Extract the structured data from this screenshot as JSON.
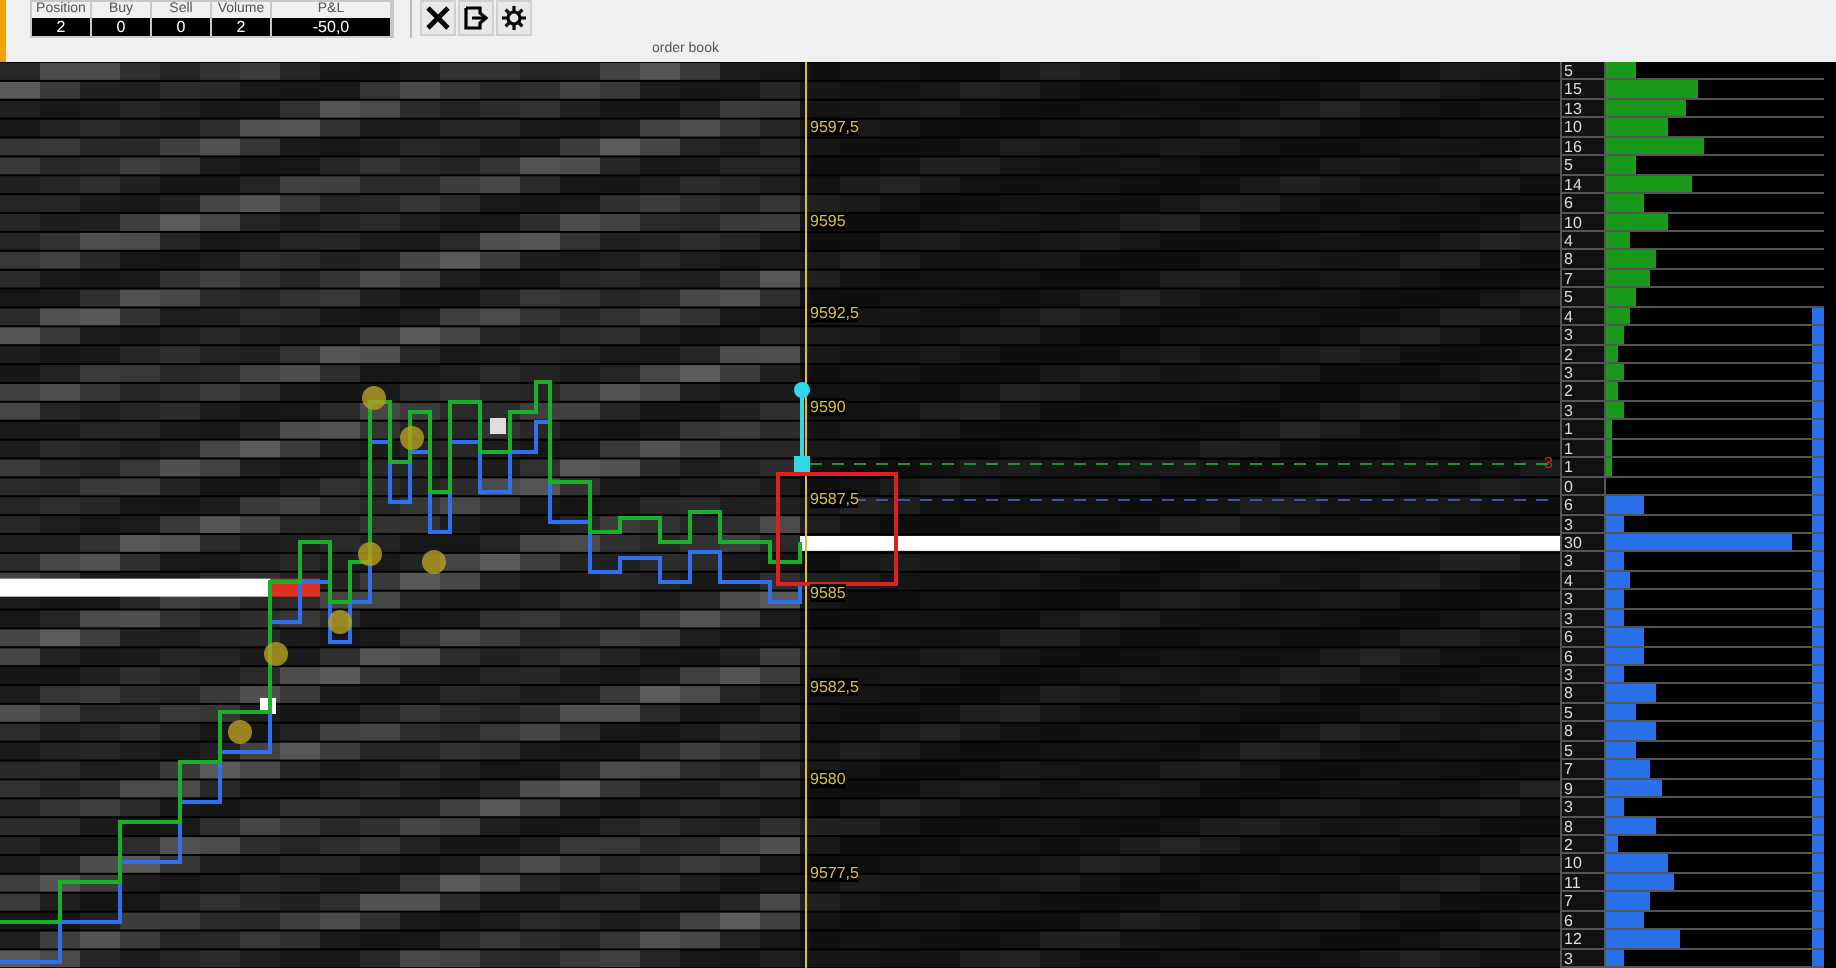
{
  "toolbar": {
    "stats": [
      {
        "label": "Position",
        "value": "2"
      },
      {
        "label": "Buy",
        "value": "0"
      },
      {
        "label": "Sell",
        "value": "0"
      },
      {
        "label": "Volume",
        "value": "2"
      },
      {
        "label": "P&L",
        "value": "-50,0"
      }
    ],
    "buttons": [
      {
        "kind": "close"
      },
      {
        "kind": "exit"
      },
      {
        "kind": "settings"
      }
    ]
  },
  "header": {
    "title": "order book"
  },
  "chart": {
    "price_labels": [
      "9597,5",
      "9595",
      "9592,5",
      "9590",
      "9587,5",
      "9585",
      "9582,5",
      "9580",
      "9577,5"
    ],
    "order_marker": "3"
  },
  "ladder": {
    "rows": [
      {
        "size": "5",
        "kind": "ask",
        "level": 0.15
      },
      {
        "size": "15",
        "kind": "ask",
        "level": 0.45
      },
      {
        "size": "13",
        "kind": "ask",
        "level": 0.39
      },
      {
        "size": "10",
        "kind": "ask",
        "level": 0.3
      },
      {
        "size": "16",
        "kind": "ask",
        "level": 0.48
      },
      {
        "size": "5",
        "kind": "ask",
        "level": 0.15
      },
      {
        "size": "14",
        "kind": "ask",
        "level": 0.42
      },
      {
        "size": "6",
        "kind": "ask",
        "level": 0.18
      },
      {
        "size": "10",
        "kind": "ask",
        "level": 0.3
      },
      {
        "size": "4",
        "kind": "ask",
        "level": 0.12
      },
      {
        "size": "8",
        "kind": "ask",
        "level": 0.24
      },
      {
        "size": "7",
        "kind": "ask",
        "level": 0.21
      },
      {
        "size": "5",
        "kind": "ask",
        "level": 0.15
      },
      {
        "size": "4",
        "kind": "ask",
        "level": 0.12
      },
      {
        "size": "3",
        "kind": "ask",
        "level": 0.09
      },
      {
        "size": "2",
        "kind": "ask",
        "level": 0.06
      },
      {
        "size": "3",
        "kind": "ask",
        "level": 0.09
      },
      {
        "size": "2",
        "kind": "ask",
        "level": 0.06
      },
      {
        "size": "3",
        "kind": "ask",
        "level": 0.09
      },
      {
        "size": "1",
        "kind": "ask",
        "level": 0.03
      },
      {
        "size": "1",
        "kind": "ask",
        "level": 0.03
      },
      {
        "size": "1",
        "kind": "ask",
        "level": 0.03
      },
      {
        "size": "0"
      },
      {
        "size": "6",
        "kind": "bid",
        "level": 0.18
      },
      {
        "size": "3",
        "kind": "bid",
        "level": 0.09
      },
      {
        "size": "30",
        "kind": "bid",
        "level": 0.9
      },
      {
        "size": "3",
        "kind": "bid",
        "level": 0.09
      },
      {
        "size": "4",
        "kind": "bid",
        "level": 0.12
      },
      {
        "size": "3",
        "kind": "bid",
        "level": 0.09
      },
      {
        "size": "3",
        "kind": "bid",
        "level": 0.09
      },
      {
        "size": "6",
        "kind": "bid",
        "level": 0.18
      },
      {
        "size": "6",
        "kind": "bid",
        "level": 0.18
      },
      {
        "size": "3",
        "kind": "bid",
        "level": 0.09
      },
      {
        "size": "8",
        "kind": "bid",
        "level": 0.24
      },
      {
        "size": "5",
        "kind": "bid",
        "level": 0.15
      },
      {
        "size": "8",
        "kind": "bid",
        "level": 0.24
      },
      {
        "size": "5",
        "kind": "bid",
        "level": 0.15
      },
      {
        "size": "7",
        "kind": "bid",
        "level": 0.21
      },
      {
        "size": "9",
        "kind": "bid",
        "level": 0.27
      },
      {
        "size": "3",
        "kind": "bid",
        "level": 0.09
      },
      {
        "size": "8",
        "kind": "bid",
        "level": 0.24
      },
      {
        "size": "2",
        "kind": "bid",
        "level": 0.06
      },
      {
        "size": "10",
        "kind": "bid",
        "level": 0.3
      },
      {
        "size": "11",
        "kind": "bid",
        "level": 0.33
      },
      {
        "size": "7",
        "kind": "bid",
        "level": 0.21
      },
      {
        "size": "6",
        "kind": "bid",
        "level": 0.18
      },
      {
        "size": "12",
        "kind": "bid",
        "level": 0.36
      },
      {
        "size": "3",
        "kind": "bid",
        "level": 0.09
      }
    ]
  }
}
